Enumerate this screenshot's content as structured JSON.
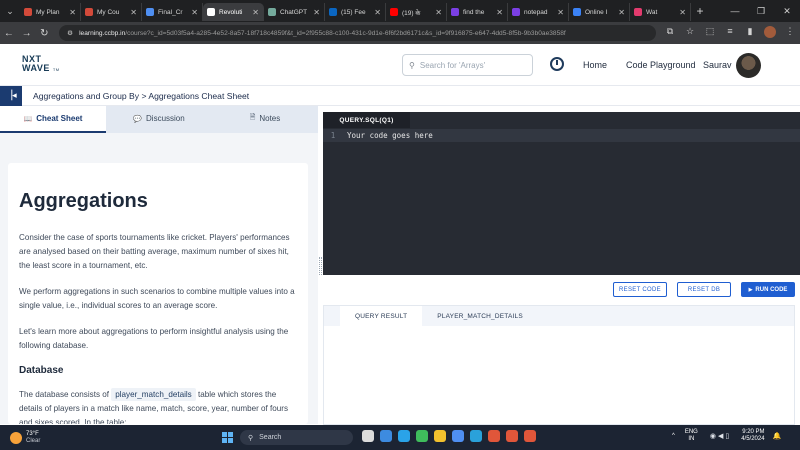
{
  "browser": {
    "tabs": [
      {
        "label": "My Plan",
        "color": "#d34a3a",
        "active": false
      },
      {
        "label": "My Cou",
        "color": "#d34a3a",
        "active": false
      },
      {
        "label": "Final_Cr",
        "color": "#4f8ff2",
        "active": false
      },
      {
        "label": "Revoluti",
        "color": "#ffffff",
        "active": true
      },
      {
        "label": "ChatGPT",
        "color": "#74aa9c",
        "active": false
      },
      {
        "label": "(15) Fee",
        "color": "#0a66c2",
        "active": false
      },
      {
        "label": "(19) के",
        "color": "#ff0000",
        "active": false
      },
      {
        "label": "find the",
        "color": "#7b3fe4",
        "active": false
      },
      {
        "label": "notepad",
        "color": "#7b3fe4",
        "active": false
      },
      {
        "label": "Online I",
        "color": "#3b82f6",
        "active": false
      },
      {
        "label": "Wat",
        "color": "#e33b6e",
        "active": false
      }
    ],
    "url_host": "learning.ccbp.in",
    "url_path": "/course?c_id=5d03f5a4-a285-4e52-8a57-18f718c4859f&t_id=2f955c88-c100-431c-9d1e-6f6f2bd6171c&s_id=9f916875-e647-4dd5-8f5b-9b3b0ae3858f"
  },
  "header": {
    "logo_line1": "NXT",
    "logo_line2": "WAVE",
    "logo_tm": "TM",
    "search_placeholder": "Search for 'Arrays'",
    "home_label": "Home",
    "code_playground_label": "Code Playground",
    "user_name": "Saurav"
  },
  "breadcrumb": "Aggregations and Group By > Aggregations Cheat Sheet",
  "left_tabs": {
    "cheat_sheet": "Cheat Sheet",
    "discussion": "Discussion",
    "notes": "Notes"
  },
  "sheet": {
    "title": "Aggregations",
    "para1": "Consider the case of sports tournaments like cricket. Players' performances are analysed based on their batting average, maximum number of sixes hit, the least score in a tournament, etc.",
    "para2": "We perform aggregations in such scenarios to combine multiple values into a single value, i.e., individual scores to an average score.",
    "para3": "Let's learn more about aggregations to perform insightful analysis using the following database.",
    "section_heading": "Database",
    "para4_before": "The database consists of ",
    "table_name": "player_match_details",
    "para4_after": " table which stores the details of players in a match like name, match, score, year, number of fours and sixes scored. In the table:"
  },
  "editor": {
    "tab_label": "QUERY.SQL(Q1)",
    "line_number": "1",
    "code_line": "Your code goes here"
  },
  "actions": {
    "reset_code": "RESET CODE",
    "reset_db": "RESET DB",
    "run_code": "RUN CODE"
  },
  "result": {
    "tab_query_result": "QUERY RESULT",
    "tab_table": "PLAYER_MATCH_DETAILS"
  },
  "taskbar": {
    "temperature": "73°F",
    "weather": "Clear",
    "search_label": "Search",
    "lang1": "ENG",
    "lang2": "IN",
    "time": "9:20 PM",
    "date": "4/5/2024",
    "app_colors": [
      "#dcdcdc",
      "#3d8be0",
      "#2aa3e8",
      "#3fbd5c",
      "#f2c12e",
      "#4f8ff2",
      "#2aa1da",
      "#e0563a",
      "#e0563a",
      "#e0563a"
    ]
  }
}
